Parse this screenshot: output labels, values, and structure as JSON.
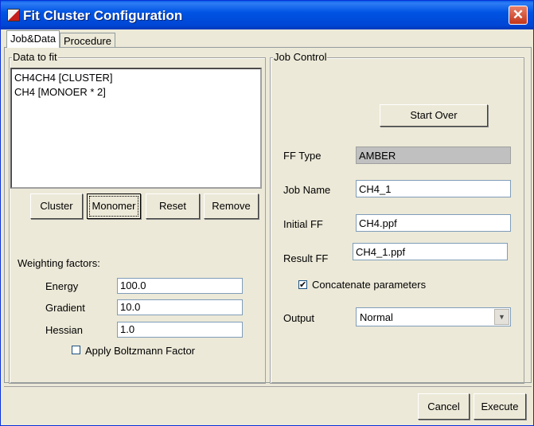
{
  "window": {
    "title": "Fit Cluster Configuration",
    "close_glyph": "✕"
  },
  "tabs": [
    {
      "label": "Job&Data"
    },
    {
      "label": "Procedure"
    }
  ],
  "data_to_fit": {
    "label": "Data to fit",
    "items": [
      "CH4CH4 [CLUSTER]",
      "CH4 [MONOER * 2]"
    ],
    "buttons": {
      "cluster": "Cluster",
      "monomer": "Monomer",
      "reset": "Reset",
      "remove": "Remove"
    }
  },
  "weighting": {
    "label": "Weighting factors:",
    "energy": {
      "label": "Energy",
      "value": "100.0"
    },
    "gradient": {
      "label": "Gradient",
      "value": "10.0"
    },
    "hessian": {
      "label": "Hessian",
      "value": "1.0"
    },
    "boltzmann": {
      "label": "Apply Boltzmann Factor",
      "checked": false
    }
  },
  "job_control": {
    "label": "Job Control",
    "start_over": "Start Over",
    "ff_type": {
      "label": "FF Type",
      "value": "AMBER"
    },
    "job_name": {
      "label": "Job Name",
      "value": "CH4_1"
    },
    "initial_ff": {
      "label": "Initial FF",
      "value": "CH4.ppf"
    },
    "result_ff": {
      "label": "Result FF",
      "value": "CH4_1.ppf"
    },
    "concatenate": {
      "label": "Concatenate parameters",
      "checked": true,
      "check_glyph": "✔"
    },
    "output": {
      "label": "Output",
      "value": "Normal",
      "arrow_glyph": "▼"
    }
  },
  "footer": {
    "cancel": "Cancel",
    "execute": "Execute"
  }
}
